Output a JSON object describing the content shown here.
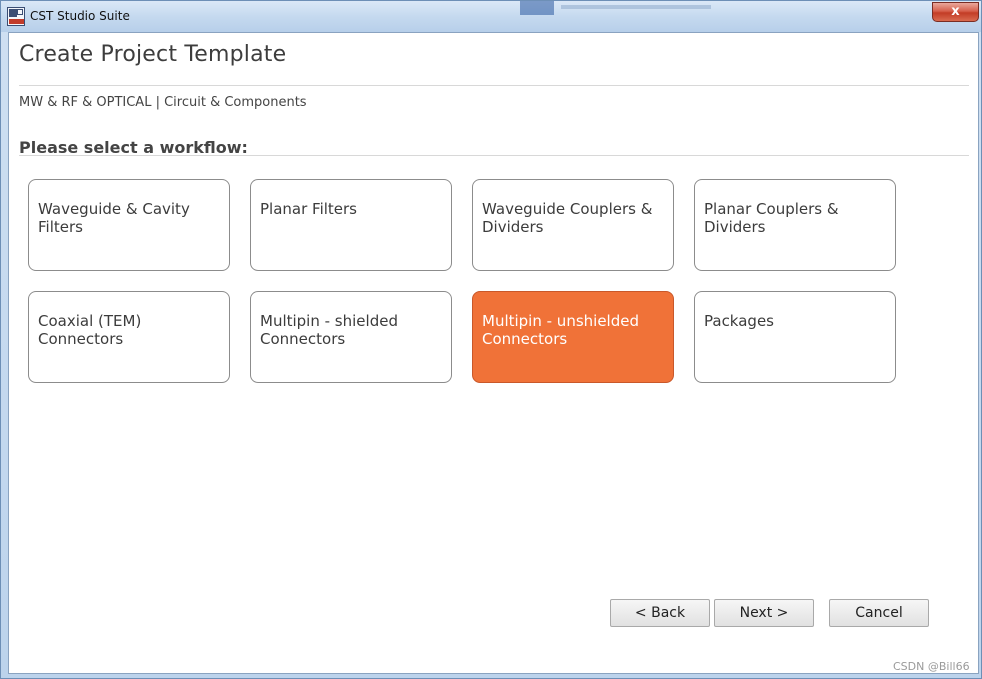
{
  "window": {
    "title": "CST Studio Suite",
    "close_glyph": "x",
    "icon_top_text": "",
    "icon_year": ""
  },
  "page": {
    "heading": "Create Project Template",
    "breadcrumb": "MW & RF & OPTICAL | Circuit & Components",
    "section_title": "Please select a workflow:"
  },
  "workflows": [
    {
      "label": "Waveguide & Cavity Filters",
      "selected": false
    },
    {
      "label": "Planar Filters",
      "selected": false
    },
    {
      "label": "Waveguide Couplers & Dividers",
      "selected": false
    },
    {
      "label": "Planar Couplers & Dividers",
      "selected": false
    },
    {
      "label": "Coaxial (TEM) Connectors",
      "selected": false
    },
    {
      "label": "Multipin - shielded Connectors",
      "selected": false
    },
    {
      "label": "Multipin - unshielded Connectors",
      "selected": true
    },
    {
      "label": "Packages",
      "selected": false
    }
  ],
  "buttons": {
    "back": "< Back",
    "next": "Next >",
    "cancel": "Cancel"
  },
  "watermark": "CSDN @Bill66",
  "colors": {
    "selected_tile": "#f07238",
    "close_button": "#c33c26"
  }
}
